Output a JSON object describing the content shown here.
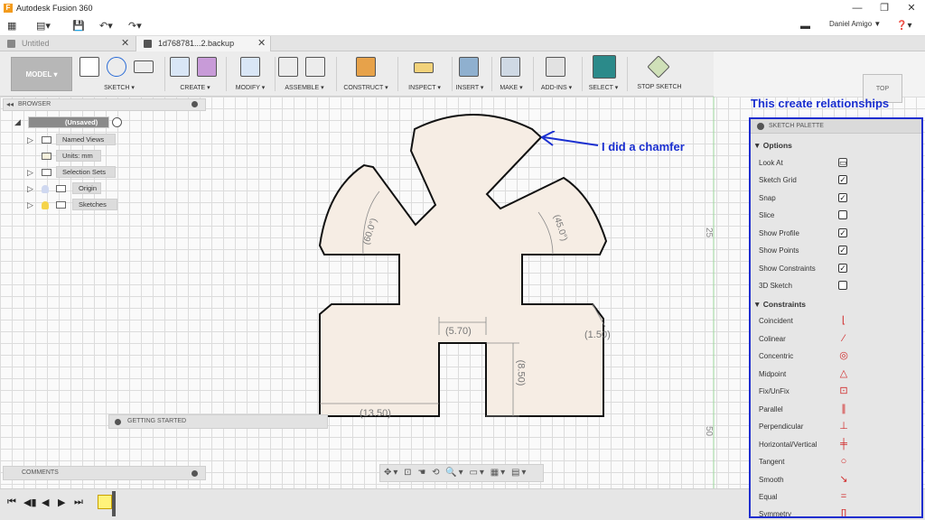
{
  "window": {
    "title": "Autodesk Fusion 360",
    "icon_letter": "F",
    "minimize": "—",
    "maximize": "❐",
    "close": "✕"
  },
  "quickbar": {
    "user": "Daniel Amigo ▼",
    "help": "❓▾"
  },
  "tabs": [
    {
      "label": "Untitled",
      "close": "✕"
    },
    {
      "label": "1d768781...2.backup",
      "close": "✕"
    }
  ],
  "toolbar": {
    "workspace": "MODEL ▾",
    "groups": [
      "SKETCH ▾",
      "CREATE ▾",
      "MODIFY ▾",
      "ASSEMBLE ▾",
      "CONSTRUCT ▾",
      "INSPECT ▾",
      "INSERT ▾",
      "MAKE ▾",
      "ADD-INS ▾",
      "SELECT ▾",
      "STOP SKETCH"
    ]
  },
  "browser": {
    "header": "BROWSER",
    "root": "(Unsaved)",
    "items": [
      "Named Views",
      "Units: mm",
      "Selection Sets",
      "Origin",
      "Sketches"
    ]
  },
  "panels": {
    "getting_started": "GETTING STARTED",
    "comments": "COMMENTS"
  },
  "navbar": {
    "icons": "✥▾ ⊡ ☚ ⟲ 🔍▾  ▭▾ ▦▾ ▤▾"
  },
  "viewcube": {
    "label": "TOP"
  },
  "canvas": {
    "ruler_marks": [
      "25",
      "50"
    ],
    "dimensions": [
      "(60.0°)",
      "(45.0°)",
      "(5.70)",
      "(1.50)",
      "(8.50)",
      "(13.50)"
    ]
  },
  "annotations": {
    "top_note": "This create relationships",
    "chamfer_note": "I did a chamfer"
  },
  "palette": {
    "title": "SKETCH PALETTE",
    "options_header": "▼ Options",
    "options": [
      {
        "label": "Look At",
        "control": "button"
      },
      {
        "label": "Sketch Grid",
        "control": "checkbox",
        "checked": true
      },
      {
        "label": "Snap",
        "control": "checkbox",
        "checked": true
      },
      {
        "label": "Slice",
        "control": "checkbox",
        "checked": false
      },
      {
        "label": "Show Profile",
        "control": "checkbox",
        "checked": true
      },
      {
        "label": "Show Points",
        "control": "checkbox",
        "checked": true
      },
      {
        "label": "Show Constraints",
        "control": "checkbox",
        "checked": true
      },
      {
        "label": "3D Sketch",
        "control": "checkbox",
        "checked": false
      }
    ],
    "constraints_header": "▼ Constraints",
    "constraints": [
      {
        "label": "Coincident",
        "icon": "coincident-icon"
      },
      {
        "label": "Colinear",
        "icon": "colinear-icon"
      },
      {
        "label": "Concentric",
        "icon": "concentric-icon"
      },
      {
        "label": "Midpoint",
        "icon": "midpoint-icon"
      },
      {
        "label": "Fix/UnFix",
        "icon": "lock-icon"
      },
      {
        "label": "Parallel",
        "icon": "parallel-icon"
      },
      {
        "label": "Perpendicular",
        "icon": "perpendicular-icon"
      },
      {
        "label": "Horizontal/Vertical",
        "icon": "horizontal-vertical-icon"
      },
      {
        "label": "Tangent",
        "icon": "tangent-icon"
      },
      {
        "label": "Smooth",
        "icon": "smooth-icon"
      },
      {
        "label": "Equal",
        "icon": "equal-icon"
      },
      {
        "label": "Symmetry",
        "icon": "symmetry-icon"
      }
    ]
  },
  "colors": {
    "annotation_blue": "#1a2fd0",
    "constraint_red": "#d12a2a",
    "profile_fill": "#f6ede4"
  }
}
